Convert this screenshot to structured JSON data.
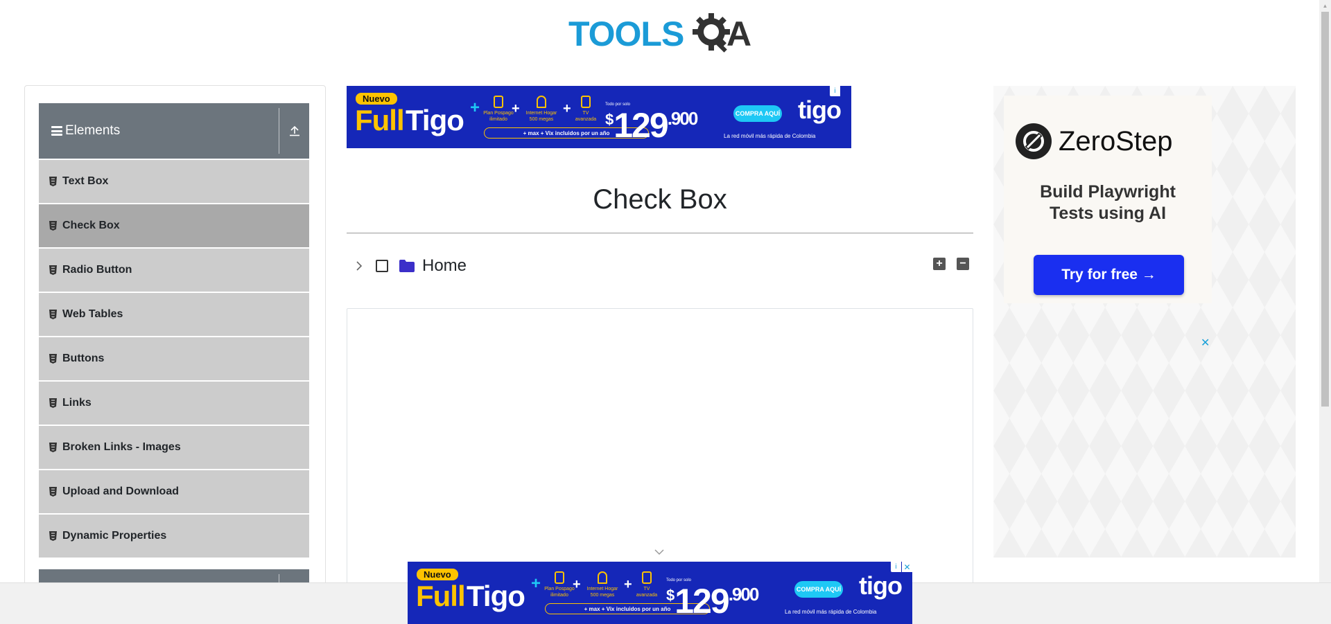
{
  "header": {
    "logo_text_1": "TOOLS",
    "logo_text_2": "QA"
  },
  "sidebar": {
    "group_title": "Elements",
    "items": [
      {
        "label": "Text Box",
        "active": false
      },
      {
        "label": "Check Box",
        "active": true
      },
      {
        "label": "Radio Button",
        "active": false
      },
      {
        "label": "Web Tables",
        "active": false
      },
      {
        "label": "Buttons",
        "active": false
      },
      {
        "label": "Links",
        "active": false
      },
      {
        "label": "Broken Links - Images",
        "active": false
      },
      {
        "label": "Upload and Download",
        "active": false
      },
      {
        "label": "Dynamic Properties",
        "active": false
      }
    ]
  },
  "main": {
    "title": "Check Box",
    "tree": {
      "root_label": "Home",
      "expand_all_symbol": "+",
      "collapse_all_symbol": "−"
    }
  },
  "ad_tigo": {
    "badge": "Nuevo",
    "full": "Full",
    "tigo": "Tigo",
    "plus": "+",
    "feature_1": "Plan Pospago ilimitado",
    "feature_2": "Internet Hogar 500 megas",
    "feature_3": "TV avanzada",
    "pill_text": "+ max + Vix incluidos por un año",
    "todo_por_solo": "Todo por solo",
    "currency": "$",
    "price_main": "129",
    "price_decimal": ".900",
    "cta": "COMPRA AQUÍ",
    "brand": "tigo",
    "tagline": "La red móvil más rápida de Colombia",
    "info_symbol": "i",
    "close_symbol": "✕"
  },
  "ad_zerostep": {
    "brand_name": "ZeroStep",
    "headline_line1": "Build Playwright",
    "headline_line2": "Tests using AI",
    "cta": "Try for free →",
    "close_symbol": "✕"
  },
  "colors": {
    "logo_blue": "#1b9bd7",
    "logo_dark": "#333333",
    "sidebar_header": "#6c757d",
    "menu_item": "#cccccc",
    "menu_item_active": "#a9a9a9",
    "folder_icon": "#3b2fc9",
    "tigo_blue": "#1527b8",
    "tigo_yellow": "#fdc300",
    "zerostep_button": "#1a2ff0"
  }
}
